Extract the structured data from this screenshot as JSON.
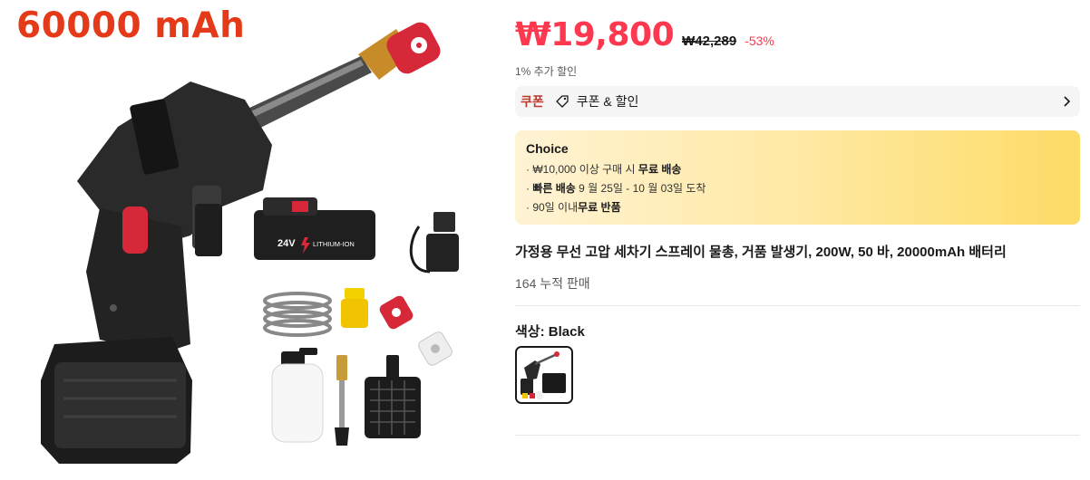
{
  "product_image": {
    "capacity_text": "60000 mAh",
    "battery_text": "24V",
    "battery_brand": "LITHIUM-ION"
  },
  "price": {
    "current": "₩19,800",
    "original": "₩42,289",
    "discount": "-53%",
    "extra_discount": "1% 추가 할인"
  },
  "coupon": {
    "tag": "쿠폰",
    "label": "쿠폰 & 할인"
  },
  "choice": {
    "title": "Choice",
    "lines": [
      {
        "prefix": "· ₩10,000 이상 구매 시 ",
        "strong": "무료 배송",
        "suffix": ""
      },
      {
        "prefix": "· ",
        "strong": "빠른 배송",
        "suffix": " 9 월 25일 - 10 월 03일 도착"
      },
      {
        "prefix": "· 90일 이내",
        "strong": "무료 반품",
        "suffix": ""
      }
    ]
  },
  "product": {
    "title": "가정용 무선 고압 세차기 스프레이 물총, 거품 발생기, 200W, 50 바, 20000mAh 배터리",
    "sold": "164 누적 판매"
  },
  "variant": {
    "label": "색상: Black"
  },
  "colors": {
    "price_red": "#fd384f",
    "coupon_red": "#c0392b",
    "choice_gradient_start": "#fff3d4",
    "choice_gradient_end": "#fddb67"
  },
  "icons": {
    "coupon": "tag-icon",
    "chevron": "chevron-right-icon"
  }
}
